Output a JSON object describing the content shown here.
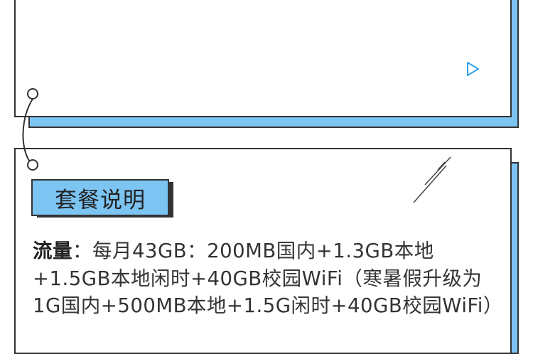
{
  "package": {
    "section_label": "套餐说明",
    "desc_key": "流量",
    "desc_text": "：每月43GB：200MB国内+1.3GB本地+1.5GB本地闲时+40GB校园WiFi（寒暑假升级为1G国内+500MB本地+1.5G闲时+40GB校园WiFi）"
  },
  "colors": {
    "accent": "#7cc4f2",
    "outline": "#333333",
    "play": "#2ea3e6"
  },
  "icons": {
    "play": "play-outline-icon"
  }
}
